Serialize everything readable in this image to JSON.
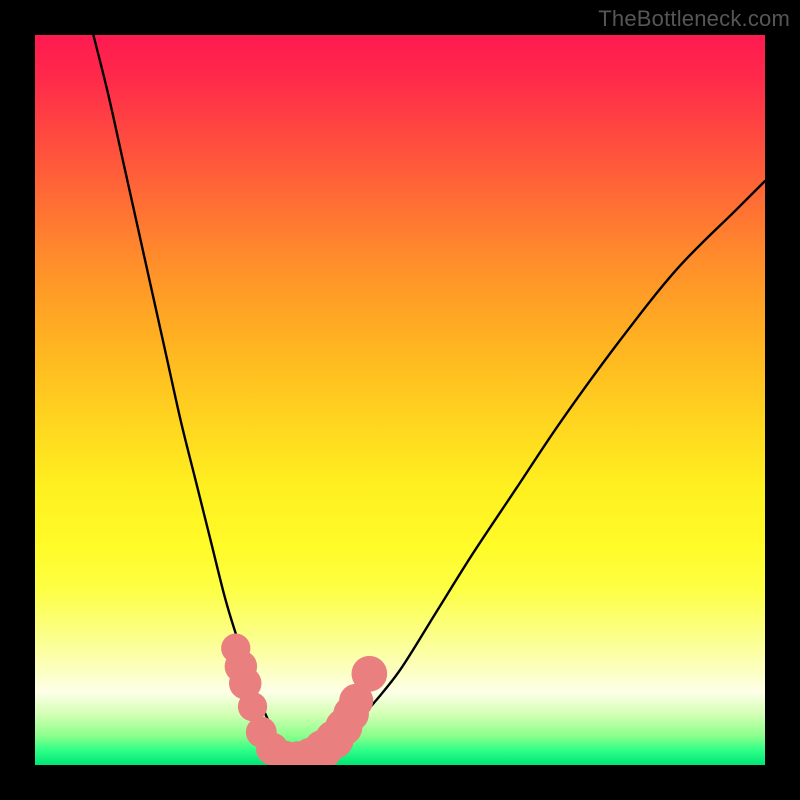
{
  "watermark": "TheBottleneck.com",
  "colors": {
    "frame": "#000000",
    "curve": "#000000",
    "marker": "#e9807f",
    "gradient_top": "#ff1a50",
    "gradient_bottom": "#00e574"
  },
  "chart_data": {
    "type": "line",
    "title": "",
    "xlabel": "",
    "ylabel": "",
    "xlim": [
      0,
      100
    ],
    "ylim": [
      0,
      100
    ],
    "grid": false,
    "legend": false,
    "annotations": [
      "TheBottleneck.com"
    ],
    "series": [
      {
        "name": "bottleneck-curve",
        "x": [
          8,
          10,
          12,
          14,
          16,
          18,
          20,
          22,
          24,
          26,
          27.5,
          29,
          30.5,
          32,
          33,
          34,
          35,
          36.5,
          38,
          40,
          43,
          46,
          50,
          55,
          60,
          66,
          72,
          80,
          88,
          96,
          100
        ],
        "y": [
          100,
          92,
          83,
          74,
          65,
          56,
          47,
          39,
          31,
          23,
          18,
          13.5,
          9.5,
          6,
          4,
          2.5,
          1.5,
          1,
          1.2,
          2,
          4.5,
          8,
          13,
          21,
          29,
          38,
          47,
          58,
          68,
          76,
          80
        ]
      }
    ],
    "markers": [
      {
        "name": "marker-cluster",
        "x": 27.5,
        "y": 16,
        "r": 1.2
      },
      {
        "name": "marker-cluster",
        "x": 28.2,
        "y": 13.5,
        "r": 1.4
      },
      {
        "name": "marker-cluster",
        "x": 28.8,
        "y": 11.2,
        "r": 1.4
      },
      {
        "name": "marker-cluster",
        "x": 29.8,
        "y": 8.0,
        "r": 1.2
      },
      {
        "name": "marker-cluster",
        "x": 31.0,
        "y": 4.5,
        "r": 1.3
      },
      {
        "name": "marker-cluster",
        "x": 32.5,
        "y": 2.2,
        "r": 1.4
      },
      {
        "name": "marker-cluster",
        "x": 34.2,
        "y": 1.0,
        "r": 1.5
      },
      {
        "name": "marker-cluster",
        "x": 36.0,
        "y": 0.8,
        "r": 1.6
      },
      {
        "name": "marker-cluster",
        "x": 37.8,
        "y": 1.2,
        "r": 1.7
      },
      {
        "name": "marker-cluster",
        "x": 39.5,
        "y": 2.2,
        "r": 1.8
      },
      {
        "name": "marker-cluster",
        "x": 41.0,
        "y": 3.5,
        "r": 1.8
      },
      {
        "name": "marker-cluster",
        "x": 42.3,
        "y": 5.2,
        "r": 1.7
      },
      {
        "name": "marker-cluster",
        "x": 43.3,
        "y": 7.0,
        "r": 1.6
      },
      {
        "name": "marker-cluster",
        "x": 44.0,
        "y": 8.8,
        "r": 1.5
      },
      {
        "name": "marker-cluster",
        "x": 45.8,
        "y": 12.5,
        "r": 1.6
      }
    ]
  }
}
